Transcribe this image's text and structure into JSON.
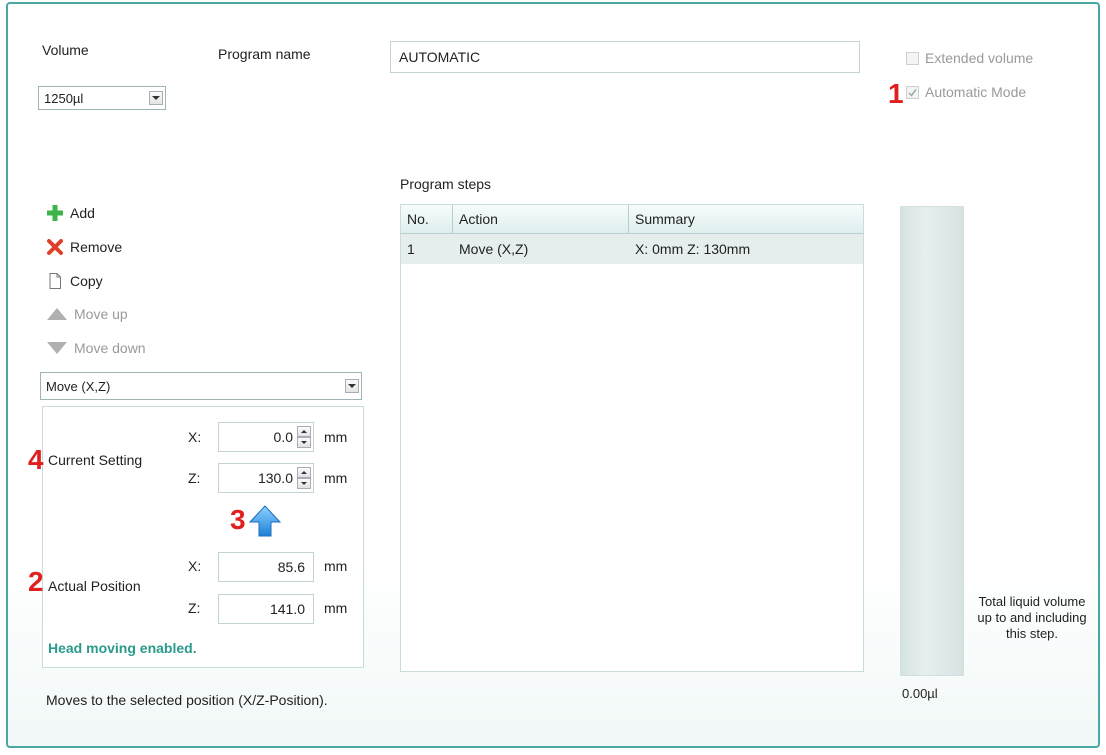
{
  "volume": {
    "label": "Volume",
    "selected": "1250µl"
  },
  "program_name": {
    "label": "Program name",
    "value": "AUTOMATIC"
  },
  "options": {
    "extended_volume": {
      "label": "Extended volume",
      "checked": false,
      "enabled": false
    },
    "automatic_mode": {
      "label": "Automatic Mode",
      "checked": true,
      "enabled": false
    }
  },
  "callouts": {
    "n1": "1",
    "n2": "2",
    "n3": "3",
    "n4": "4"
  },
  "actions": {
    "add": "Add",
    "remove": "Remove",
    "copy": "Copy",
    "move_up": "Move up",
    "move_down": "Move down"
  },
  "action_type": {
    "selected": "Move (X,Z)"
  },
  "current_setting": {
    "label": "Current Setting",
    "x_label": "X:",
    "x_value": "0.0",
    "x_unit": "mm",
    "z_label": "Z:",
    "z_value": "130.0",
    "z_unit": "mm"
  },
  "actual_position": {
    "label": "Actual Position",
    "x_label": "X:",
    "x_value": "85.6",
    "x_unit": "mm",
    "z_label": "Z:",
    "z_value": "141.0",
    "z_unit": "mm"
  },
  "status": "Head moving enabled.",
  "program_steps": {
    "label": "Program steps",
    "columns": [
      "No.",
      "Action",
      "Summary"
    ],
    "rows": [
      {
        "no": "1",
        "action": "Move (X,Z)",
        "summary": "X: 0mm Z: 130mm"
      }
    ]
  },
  "volume_bar": {
    "caption": "Total liquid volume up to and including this step.",
    "value": "0.00µl"
  },
  "description": "Moves to the selected position (X/Z-Position).",
  "colors": {
    "accent": "#4aa8a2",
    "status_text": "#2a9a8a",
    "callout": "#e02020",
    "arrow": "#2f8fe0"
  }
}
